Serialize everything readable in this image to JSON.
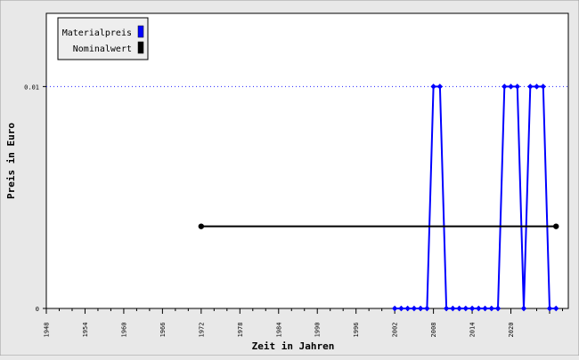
{
  "chart_data": {
    "type": "line",
    "title": "",
    "xlabel": "Zeit in Jahren",
    "ylabel": "Preis in Euro",
    "xlim": [
      1948,
      2025
    ],
    "ylim": [
      0,
      0.0133
    ],
    "x_ticks": [
      "1948",
      "1954",
      "1960",
      "1966",
      "1972",
      "1978",
      "1984",
      "1990",
      "1996",
      "2002",
      "2008",
      "2014",
      "2020"
    ],
    "y_ticks": [
      {
        "value": 0,
        "label": "0"
      },
      {
        "value": 0.01,
        "label": "0.01"
      }
    ],
    "reference_line": {
      "y": 0.01,
      "style": "dotted",
      "color": "#2222ff"
    },
    "legend": {
      "position": "top-left"
    },
    "series": [
      {
        "name": "Materialpreis",
        "color": "#0000ff",
        "points": [
          [
            2002,
            0
          ],
          [
            2003,
            0
          ],
          [
            2004,
            0
          ],
          [
            2005,
            0
          ],
          [
            2006,
            0
          ],
          [
            2007,
            0
          ],
          [
            2008,
            0.01
          ],
          [
            2009,
            0.01
          ],
          [
            2010,
            0
          ],
          [
            2011,
            0
          ],
          [
            2012,
            0
          ],
          [
            2013,
            0
          ],
          [
            2014,
            0
          ],
          [
            2015,
            0
          ],
          [
            2016,
            0
          ],
          [
            2017,
            0
          ],
          [
            2018,
            0
          ],
          [
            2019,
            0.01
          ],
          [
            2020,
            0.01
          ],
          [
            2021,
            0.01
          ],
          [
            2022,
            0
          ],
          [
            2023,
            0.01
          ],
          [
            2024,
            0.01
          ],
          [
            2025,
            0.01
          ],
          [
            2026,
            0
          ],
          [
            2027,
            0
          ]
        ]
      },
      {
        "name": "Nominalwert",
        "color": "#000000",
        "points": [
          [
            1972,
            0.0037
          ],
          [
            2027,
            0.0037
          ]
        ]
      }
    ]
  }
}
